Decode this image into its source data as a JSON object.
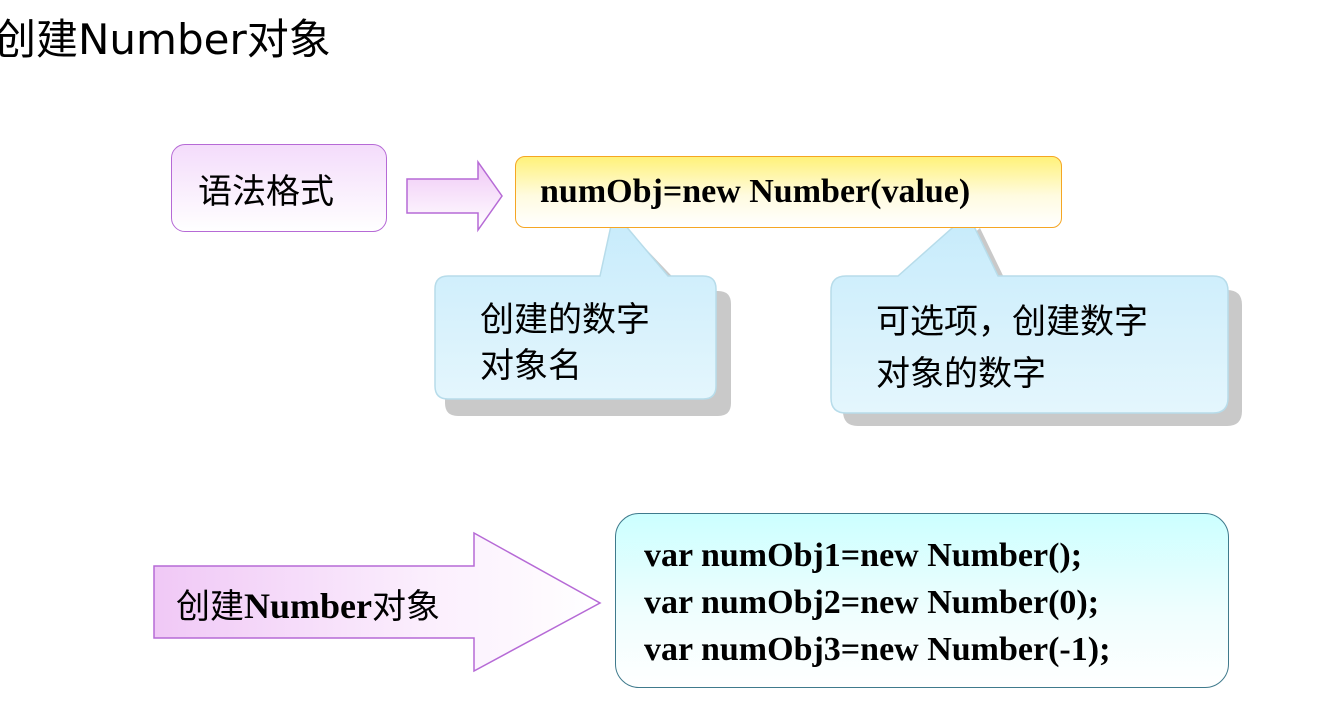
{
  "title": "创建Number对象",
  "syntax": {
    "label": "语法格式",
    "code": "numObj=new Number(value)"
  },
  "callouts": [
    {
      "lines": [
        "创建的数字",
        "对象名"
      ]
    },
    {
      "lines": [
        "可选项，创建数字",
        "对象的数字"
      ]
    }
  ],
  "example": {
    "arrow_label_cn1": "创建",
    "arrow_label_en": "Number",
    "arrow_label_cn2": "对象",
    "code_lines": [
      "var numObj1=new Number();",
      "var numObj2=new Number(0);",
      "var numObj3=new Number(-1);"
    ]
  },
  "colors": {
    "purple_border": "#b66ad6",
    "orange_border": "#f5a623",
    "callout_fill": "#cdeefb",
    "teal_border": "#3f7a8c"
  }
}
